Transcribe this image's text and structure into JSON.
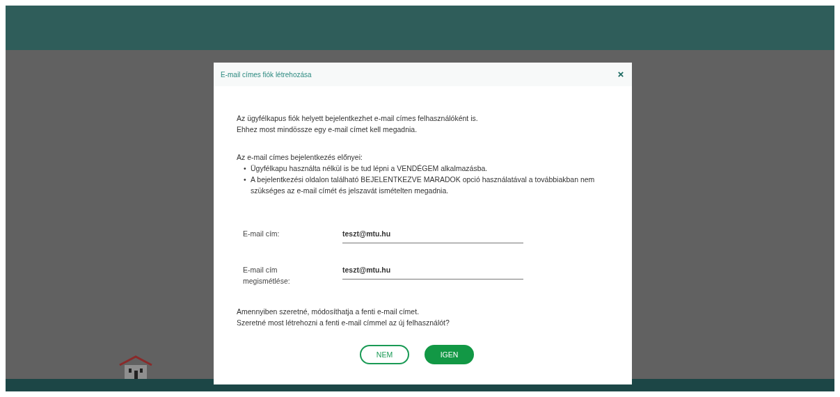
{
  "dialog": {
    "title": "E-mail címes fiók létrehozása",
    "intro": [
      "Az ügyfélkapus fiók helyett bejelentkezhet e-mail címes felhasználóként is.",
      "Ehhez most mindössze egy e-mail címet kell megadnia."
    ],
    "benefits_heading": "Az e-mail címes bejelentkezés előnyei:",
    "benefits": [
      {
        "marker": "•",
        "text": "Ügyfélkapu használta nélkül is be tud lépni a VENDÉGEM alkalmazásba."
      },
      {
        "marker": "•",
        "text": "A bejelentkezési oldalon található BEJELENTKEZVE MARADOK opció használatával a továbbiakban nem szükséges az e-mail címét és jelszavát ismételten megadnia."
      }
    ],
    "fields": [
      {
        "label": "E-mail cím:",
        "value": "teszt@mtu.hu"
      },
      {
        "label": "E-mail cím megismétlése:",
        "value": "teszt@mtu.hu"
      }
    ],
    "closing": [
      "Amennyiben szeretné, módosíthatja a fenti e-mail címet.",
      "Szeretné most létrehozni a fenti e-mail címmel az új felhasználót?"
    ],
    "buttons": [
      {
        "label": "NEM",
        "kind": "secondary"
      },
      {
        "label": "IGEN",
        "kind": "primary"
      }
    ]
  }
}
